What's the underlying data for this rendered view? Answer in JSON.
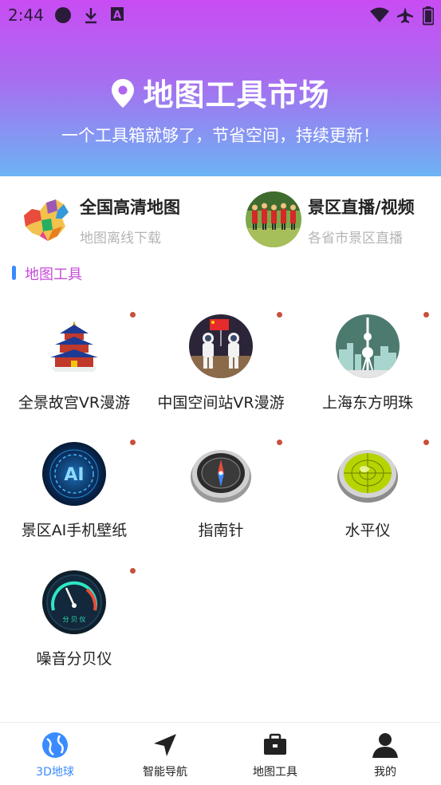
{
  "status_bar": {
    "time": "2:44",
    "left_icons": [
      "circle-icon",
      "download-icon",
      "font-icon"
    ],
    "right_icons": [
      "wifi-icon",
      "airplane-icon",
      "battery-icon"
    ]
  },
  "hero": {
    "icon": "location-pin-icon",
    "title": "地图工具市场",
    "subtitle": "一个工具箱就够了，节省空间，持续更新！",
    "gradient": [
      "#c94cf3",
      "#6cb3f4"
    ]
  },
  "features": [
    {
      "title": "全国高清地图",
      "subtitle": "地图离线下载",
      "icon": "china-map-icon"
    },
    {
      "title": "景区直播/视频",
      "subtitle": "各省市景区直播",
      "icon": "scenic-photo-icon"
    }
  ],
  "section": {
    "title": "地图工具",
    "accent": "#3a8bff",
    "title_color": "#c64bd9"
  },
  "tools": [
    {
      "label": "全景故宫VR漫游",
      "icon": "temple-icon"
    },
    {
      "label": "中国空间站VR漫游",
      "icon": "astronaut-icon"
    },
    {
      "label": "上海东方明珠",
      "icon": "tv-tower-icon"
    },
    {
      "label": "景区AI手机壁纸",
      "icon": "ai-icon"
    },
    {
      "label": "指南针",
      "icon": "compass-icon"
    },
    {
      "label": "水平仪",
      "icon": "level-gauge-icon"
    },
    {
      "label": "噪音分贝仪",
      "icon": "decibel-meter-icon"
    }
  ],
  "meter_text": "分 贝 仪",
  "ai_text": "AI",
  "bottom_nav": [
    {
      "label": "3D地球",
      "icon": "globe-icon",
      "active": true
    },
    {
      "label": "智能导航",
      "icon": "navigation-arrow-icon",
      "active": false
    },
    {
      "label": "地图工具",
      "icon": "toolbox-icon",
      "active": false
    },
    {
      "label": "我的",
      "icon": "user-icon",
      "active": false
    }
  ],
  "colors": {
    "active": "#3a8bff",
    "dot": "#c8503c"
  }
}
